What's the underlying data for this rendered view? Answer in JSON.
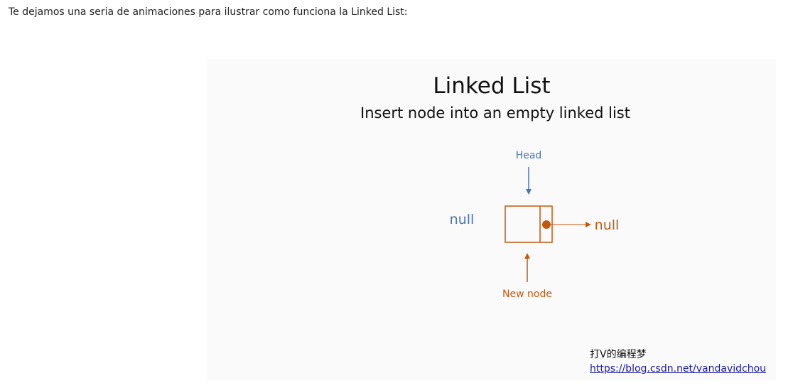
{
  "intro": {
    "text": "Te dejamos una seria de animaciones para ilustrar como funciona la Linked List:"
  },
  "slide": {
    "title": "Linked List",
    "subtitle": "Insert node into an empty linked list",
    "labels": {
      "head": "Head",
      "left_null": "null",
      "right_null": "null",
      "new_node": "New node"
    },
    "colors": {
      "blue": "#4a74b0",
      "orange": "#c05a10",
      "background": "#fafafa"
    },
    "watermark": {
      "author": "打V的编程梦",
      "url": "https://blog.csdn.net/vandavidchou"
    }
  }
}
